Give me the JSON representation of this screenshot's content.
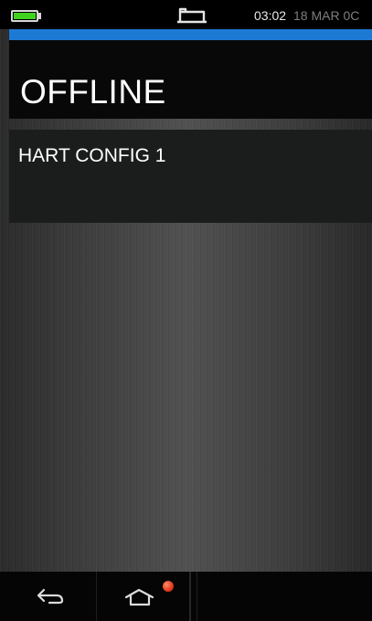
{
  "status_bar": {
    "time": "03:02",
    "date": "18 MAR 0C",
    "battery_icon": "battery-icon",
    "battery_level": 1.0,
    "connector_icon": "usb-connector-icon"
  },
  "colors": {
    "accent": "#1d7ad4",
    "battery": "#41d21f",
    "notification": "#e03a1c"
  },
  "header": {
    "title": "OFFLINE"
  },
  "list": {
    "items": [
      {
        "label": "HART CONFIG 1"
      }
    ]
  },
  "nav": {
    "back_icon": "back-arrow-icon",
    "home_icon": "home-icon",
    "home_notification": "notification-dot"
  }
}
